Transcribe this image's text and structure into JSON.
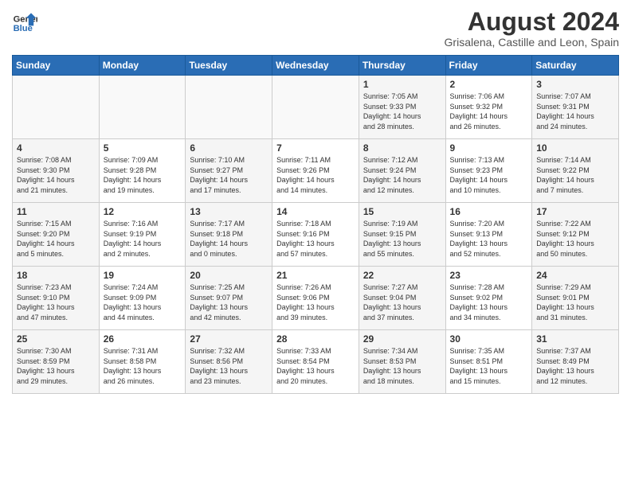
{
  "header": {
    "logo_line1": "General",
    "logo_line2": "Blue",
    "month_year": "August 2024",
    "location": "Grisalena, Castille and Leon, Spain"
  },
  "days_of_week": [
    "Sunday",
    "Monday",
    "Tuesday",
    "Wednesday",
    "Thursday",
    "Friday",
    "Saturday"
  ],
  "weeks": [
    [
      {
        "day": "",
        "info": ""
      },
      {
        "day": "",
        "info": ""
      },
      {
        "day": "",
        "info": ""
      },
      {
        "day": "",
        "info": ""
      },
      {
        "day": "1",
        "info": "Sunrise: 7:05 AM\nSunset: 9:33 PM\nDaylight: 14 hours\nand 28 minutes."
      },
      {
        "day": "2",
        "info": "Sunrise: 7:06 AM\nSunset: 9:32 PM\nDaylight: 14 hours\nand 26 minutes."
      },
      {
        "day": "3",
        "info": "Sunrise: 7:07 AM\nSunset: 9:31 PM\nDaylight: 14 hours\nand 24 minutes."
      }
    ],
    [
      {
        "day": "4",
        "info": "Sunrise: 7:08 AM\nSunset: 9:30 PM\nDaylight: 14 hours\nand 21 minutes."
      },
      {
        "day": "5",
        "info": "Sunrise: 7:09 AM\nSunset: 9:28 PM\nDaylight: 14 hours\nand 19 minutes."
      },
      {
        "day": "6",
        "info": "Sunrise: 7:10 AM\nSunset: 9:27 PM\nDaylight: 14 hours\nand 17 minutes."
      },
      {
        "day": "7",
        "info": "Sunrise: 7:11 AM\nSunset: 9:26 PM\nDaylight: 14 hours\nand 14 minutes."
      },
      {
        "day": "8",
        "info": "Sunrise: 7:12 AM\nSunset: 9:24 PM\nDaylight: 14 hours\nand 12 minutes."
      },
      {
        "day": "9",
        "info": "Sunrise: 7:13 AM\nSunset: 9:23 PM\nDaylight: 14 hours\nand 10 minutes."
      },
      {
        "day": "10",
        "info": "Sunrise: 7:14 AM\nSunset: 9:22 PM\nDaylight: 14 hours\nand 7 minutes."
      }
    ],
    [
      {
        "day": "11",
        "info": "Sunrise: 7:15 AM\nSunset: 9:20 PM\nDaylight: 14 hours\nand 5 minutes."
      },
      {
        "day": "12",
        "info": "Sunrise: 7:16 AM\nSunset: 9:19 PM\nDaylight: 14 hours\nand 2 minutes."
      },
      {
        "day": "13",
        "info": "Sunrise: 7:17 AM\nSunset: 9:18 PM\nDaylight: 14 hours\nand 0 minutes."
      },
      {
        "day": "14",
        "info": "Sunrise: 7:18 AM\nSunset: 9:16 PM\nDaylight: 13 hours\nand 57 minutes."
      },
      {
        "day": "15",
        "info": "Sunrise: 7:19 AM\nSunset: 9:15 PM\nDaylight: 13 hours\nand 55 minutes."
      },
      {
        "day": "16",
        "info": "Sunrise: 7:20 AM\nSunset: 9:13 PM\nDaylight: 13 hours\nand 52 minutes."
      },
      {
        "day": "17",
        "info": "Sunrise: 7:22 AM\nSunset: 9:12 PM\nDaylight: 13 hours\nand 50 minutes."
      }
    ],
    [
      {
        "day": "18",
        "info": "Sunrise: 7:23 AM\nSunset: 9:10 PM\nDaylight: 13 hours\nand 47 minutes."
      },
      {
        "day": "19",
        "info": "Sunrise: 7:24 AM\nSunset: 9:09 PM\nDaylight: 13 hours\nand 44 minutes."
      },
      {
        "day": "20",
        "info": "Sunrise: 7:25 AM\nSunset: 9:07 PM\nDaylight: 13 hours\nand 42 minutes."
      },
      {
        "day": "21",
        "info": "Sunrise: 7:26 AM\nSunset: 9:06 PM\nDaylight: 13 hours\nand 39 minutes."
      },
      {
        "day": "22",
        "info": "Sunrise: 7:27 AM\nSunset: 9:04 PM\nDaylight: 13 hours\nand 37 minutes."
      },
      {
        "day": "23",
        "info": "Sunrise: 7:28 AM\nSunset: 9:02 PM\nDaylight: 13 hours\nand 34 minutes."
      },
      {
        "day": "24",
        "info": "Sunrise: 7:29 AM\nSunset: 9:01 PM\nDaylight: 13 hours\nand 31 minutes."
      }
    ],
    [
      {
        "day": "25",
        "info": "Sunrise: 7:30 AM\nSunset: 8:59 PM\nDaylight: 13 hours\nand 29 minutes."
      },
      {
        "day": "26",
        "info": "Sunrise: 7:31 AM\nSunset: 8:58 PM\nDaylight: 13 hours\nand 26 minutes."
      },
      {
        "day": "27",
        "info": "Sunrise: 7:32 AM\nSunset: 8:56 PM\nDaylight: 13 hours\nand 23 minutes."
      },
      {
        "day": "28",
        "info": "Sunrise: 7:33 AM\nSunset: 8:54 PM\nDaylight: 13 hours\nand 20 minutes."
      },
      {
        "day": "29",
        "info": "Sunrise: 7:34 AM\nSunset: 8:53 PM\nDaylight: 13 hours\nand 18 minutes."
      },
      {
        "day": "30",
        "info": "Sunrise: 7:35 AM\nSunset: 8:51 PM\nDaylight: 13 hours\nand 15 minutes."
      },
      {
        "day": "31",
        "info": "Sunrise: 7:37 AM\nSunset: 8:49 PM\nDaylight: 13 hours\nand 12 minutes."
      }
    ]
  ]
}
